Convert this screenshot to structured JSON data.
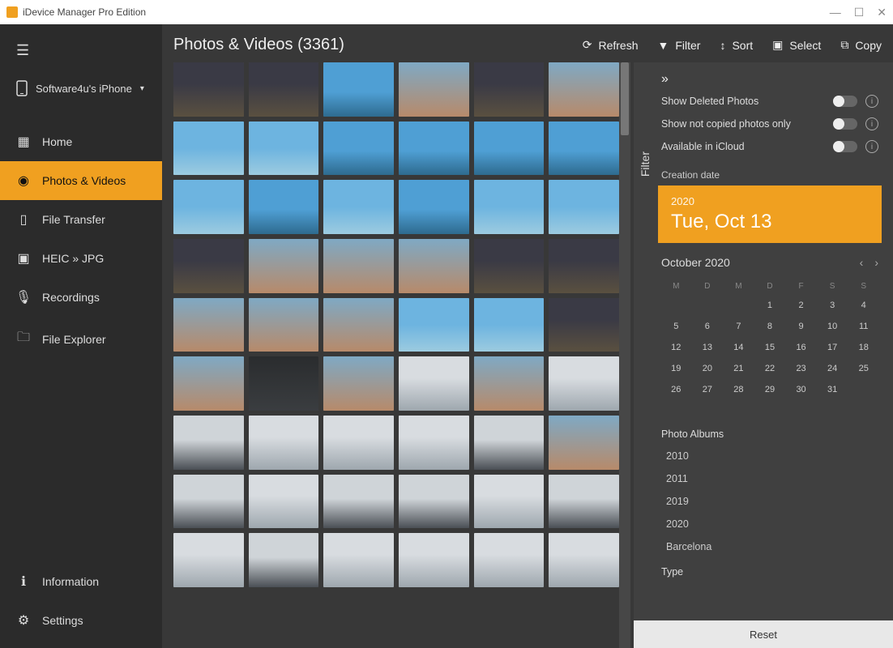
{
  "window": {
    "title": "iDevice Manager Pro Edition"
  },
  "device": {
    "name": "Software4u's iPhone"
  },
  "sidebar": {
    "items": [
      {
        "label": "Home",
        "icon": "home",
        "active": false
      },
      {
        "label": "Photos & Videos",
        "icon": "camera",
        "active": true
      },
      {
        "label": "File Transfer",
        "icon": "phone",
        "active": false
      },
      {
        "label": "HEIC » JPG",
        "icon": "image",
        "active": false
      },
      {
        "label": "Recordings",
        "icon": "mic",
        "active": false
      },
      {
        "label": "File Explorer",
        "icon": "folder",
        "active": false
      }
    ],
    "bottom": [
      {
        "label": "Information",
        "icon": "info"
      },
      {
        "label": "Settings",
        "icon": "gear"
      }
    ]
  },
  "header": {
    "title": "Photos & Videos (3361)",
    "actions": {
      "refresh": "Refresh",
      "filter": "Filter",
      "sort": "Sort",
      "select": "Select",
      "copy": "Copy"
    }
  },
  "filter": {
    "panel_label": "Filter",
    "toggles": [
      {
        "label": "Show Deleted Photos"
      },
      {
        "label": "Show not copied photos only"
      },
      {
        "label": "Available in iCloud"
      }
    ],
    "creation_date_label": "Creation date",
    "date_card": {
      "year": "2020",
      "date": "Tue, Oct 13"
    },
    "calendar": {
      "month_label": "October 2020",
      "day_headers": [
        "M",
        "D",
        "M",
        "D",
        "F",
        "S",
        "S"
      ],
      "days": [
        "",
        "",
        "",
        "1",
        "2",
        "3",
        "4",
        "5",
        "6",
        "7",
        "8",
        "9",
        "10",
        "11",
        "12",
        "13",
        "14",
        "15",
        "16",
        "17",
        "18",
        "19",
        "20",
        "21",
        "22",
        "23",
        "24",
        "25",
        "26",
        "27",
        "28",
        "29",
        "30",
        "31",
        "",
        "",
        "",
        "",
        ""
      ]
    },
    "albums_label": "Photo Albums",
    "albums": [
      "2010",
      "2011",
      "2019",
      "2020",
      "Barcelona"
    ],
    "type_label": "Type",
    "reset": "Reset"
  },
  "thumbs": [
    "city-a",
    "city-a",
    "sky-b",
    "people-a",
    "city-a",
    "people-a",
    "sky-a",
    "sky-a",
    "sky-b",
    "sky-b",
    "sky-b",
    "sky-b",
    "sky-a",
    "sky-b",
    "sky-a",
    "sky-b",
    "sky-a",
    "sky-a",
    "city-a",
    "people-a",
    "people-a",
    "people-a",
    "city-a",
    "city-a",
    "people-a",
    "people-a",
    "people-a",
    "sky-a",
    "sky-a",
    "city-a",
    "people-a",
    "dark-a",
    "people-a",
    "snow-a",
    "people-a",
    "snow-a",
    "snow-b",
    "snow-a",
    "snow-a",
    "snow-a",
    "snow-b",
    "people-a",
    "snow-b",
    "snow-a",
    "snow-b",
    "snow-b",
    "snow-a",
    "snow-b",
    "snow-a",
    "snow-b",
    "snow-a",
    "snow-a",
    "snow-a",
    "snow-a"
  ]
}
